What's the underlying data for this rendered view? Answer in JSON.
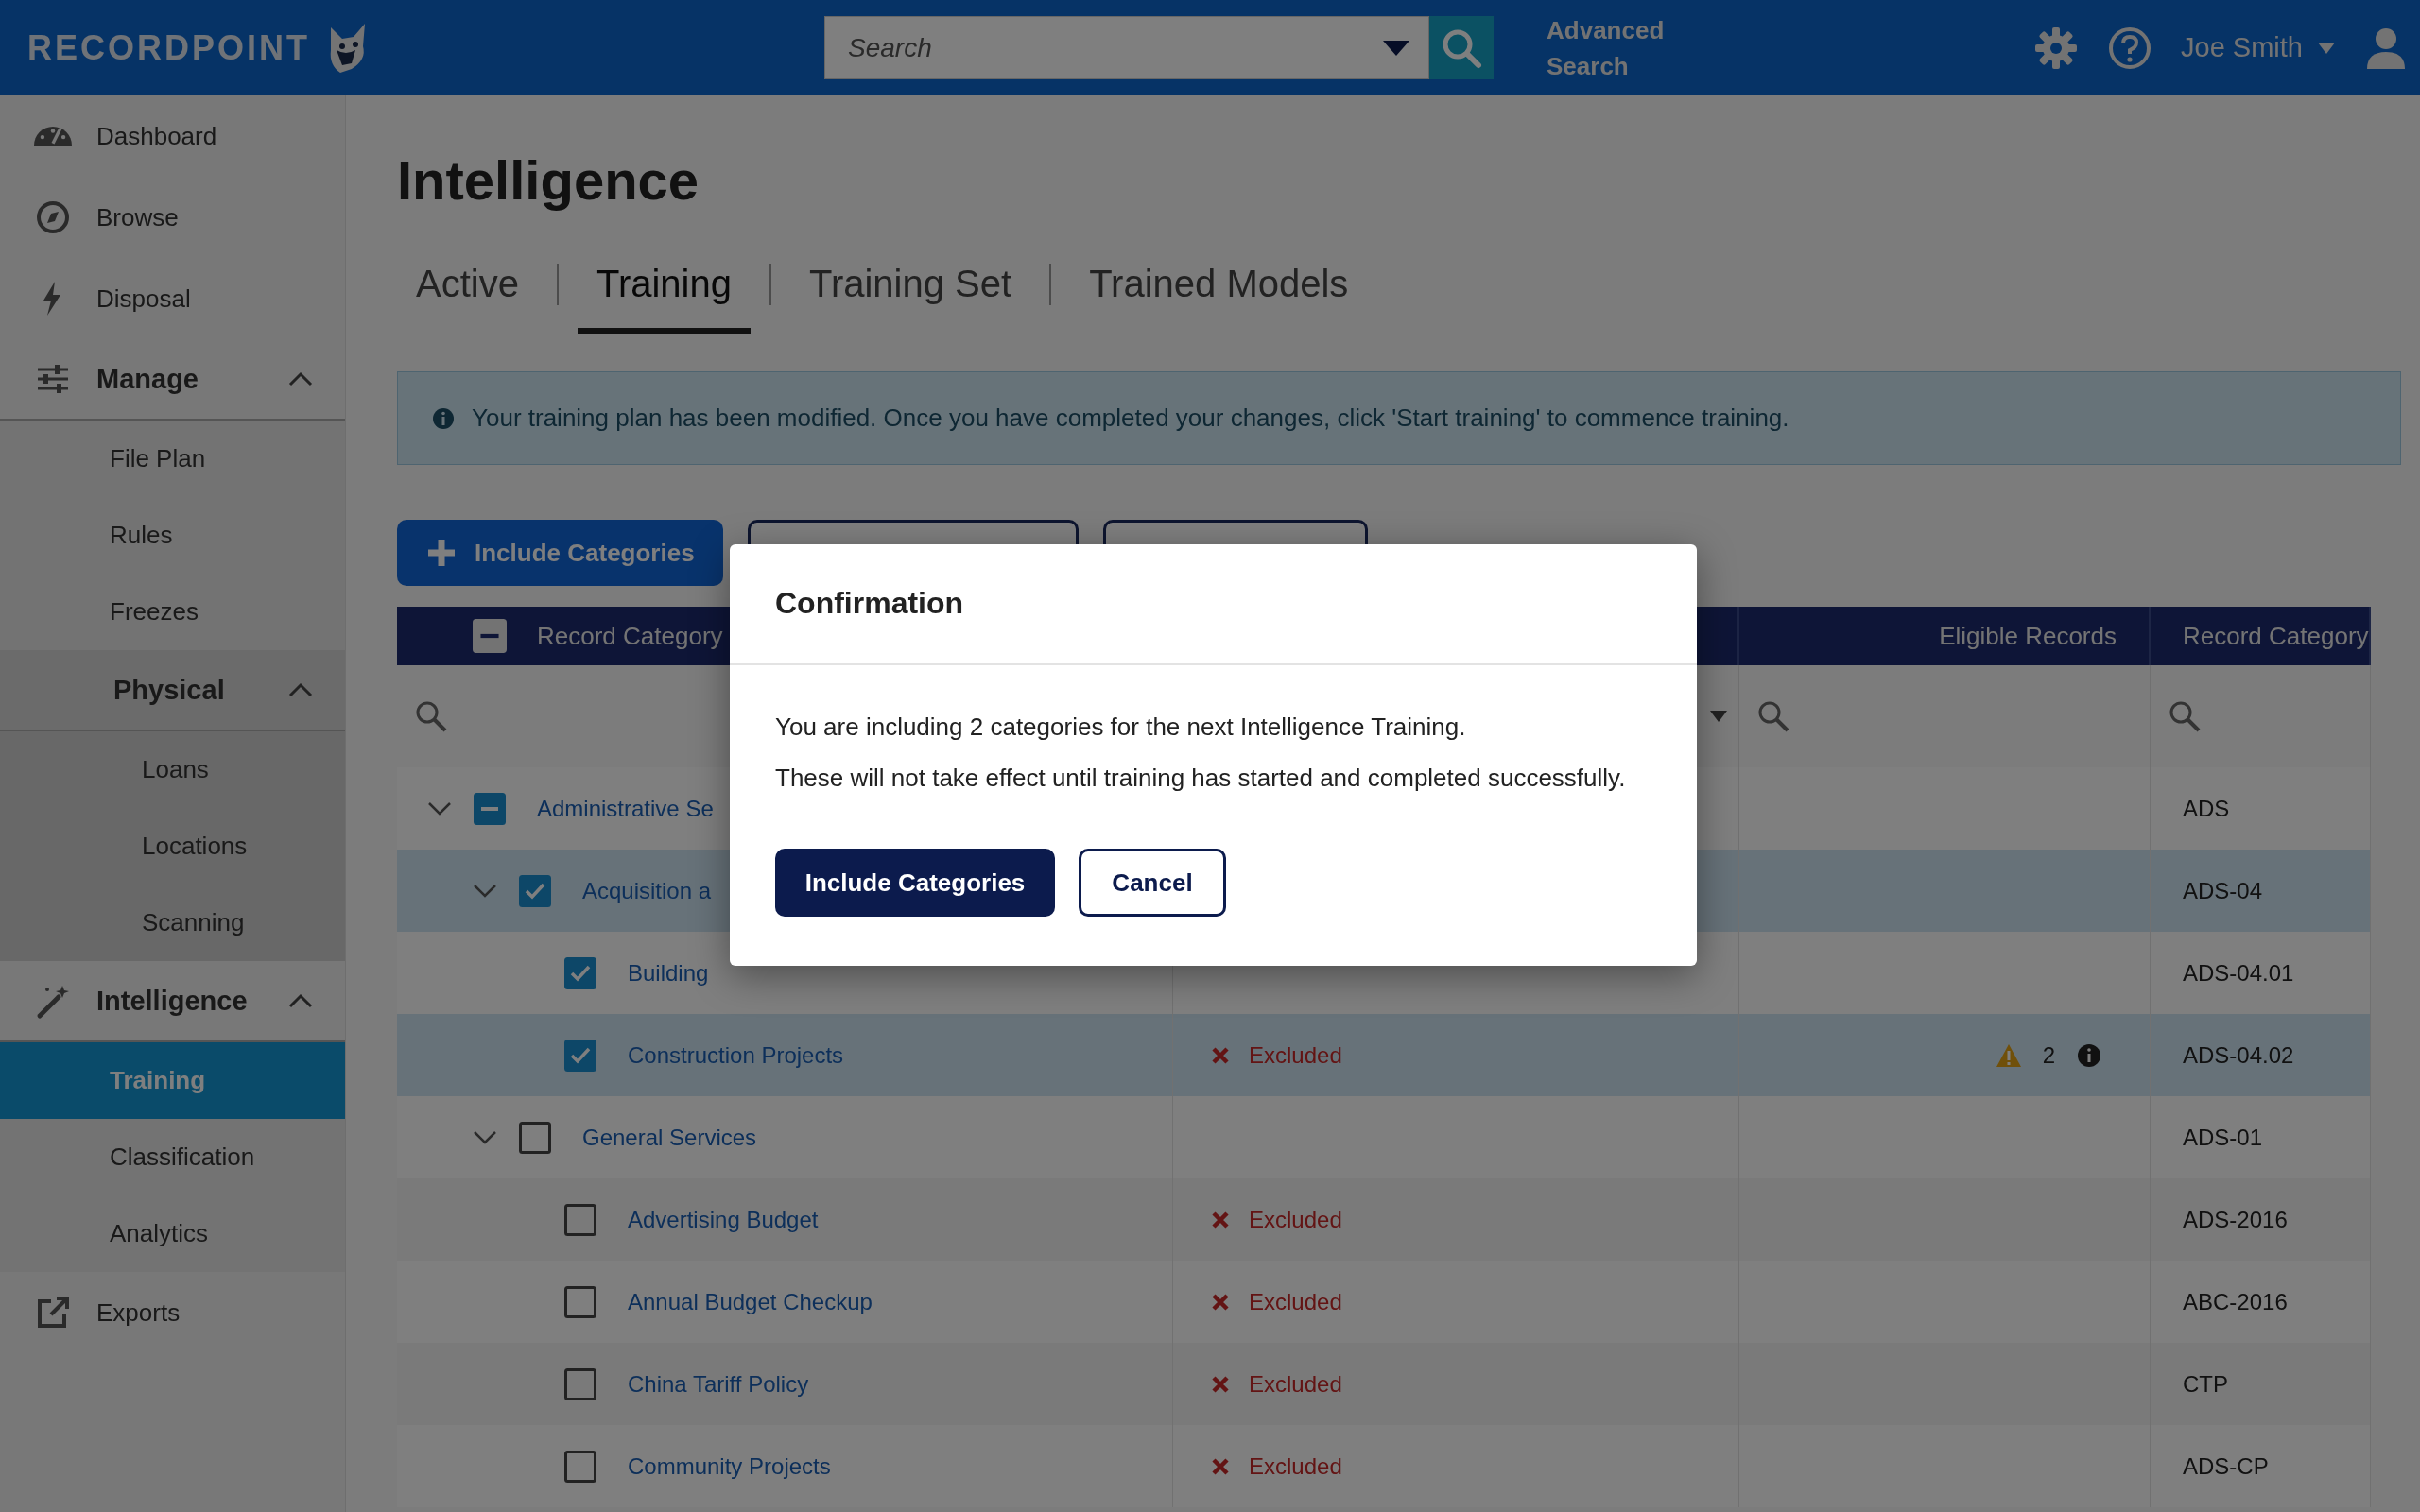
{
  "header": {
    "logo": "RECORDPOINT",
    "search": {
      "placeholder": "Search"
    },
    "advanced_search": "Advanced Search",
    "user": "Joe Smith"
  },
  "sidebar": {
    "items": [
      {
        "label": "Dashboard",
        "selected": false
      },
      {
        "label": "Browse",
        "selected": false
      },
      {
        "label": "Disposal",
        "selected": false
      },
      {
        "label": "Manage",
        "selected": false,
        "expanded": true,
        "children": [
          {
            "label": "File Plan",
            "selected": false
          },
          {
            "label": "Rules",
            "selected": false
          },
          {
            "label": "Freezes",
            "selected": false
          },
          {
            "label": "Physical",
            "selected": false,
            "expanded": true,
            "children": [
              {
                "label": "Loans",
                "selected": false
              },
              {
                "label": "Locations",
                "selected": false
              },
              {
                "label": "Scanning",
                "selected": false
              }
            ]
          }
        ]
      },
      {
        "label": "Intelligence",
        "selected": false,
        "expanded": true,
        "children": [
          {
            "label": "Training",
            "selected": true
          },
          {
            "label": "Classification",
            "selected": false
          },
          {
            "label": "Analytics",
            "selected": false
          }
        ]
      },
      {
        "label": "Exports",
        "selected": false
      }
    ]
  },
  "page": {
    "title": "Intelligence"
  },
  "tabs": [
    {
      "label": "Active",
      "selected": false
    },
    {
      "label": "Training",
      "selected": true
    },
    {
      "label": "Training Set",
      "selected": false
    },
    {
      "label": "Trained Models",
      "selected": false
    }
  ],
  "banner": {
    "message": "Your training plan has been modified. Once you have completed your changes, click 'Start training' to commence training."
  },
  "toolbar": {
    "buttons": [
      {
        "kind": "primary",
        "label": "Include Categories"
      },
      {
        "kind": "outline"
      },
      {
        "kind": "outline"
      }
    ]
  },
  "table": {
    "select_all": {
      "checked": false,
      "partial": true
    },
    "columns": [
      {
        "label": "Record Category",
        "kind": "search"
      },
      {
        "kind": "dropdown"
      },
      {
        "label": "Eligible Records",
        "kind": "search"
      },
      {
        "label": "Record Category",
        "kind": "search"
      }
    ],
    "rows": [
      {
        "name": "Administrative Se",
        "checked": false,
        "partial": true,
        "expanded": true,
        "highlighted": false,
        "code": "ADS",
        "children": [
          {
            "name": "Acquisition a",
            "checked": true,
            "partial": false,
            "expanded": true,
            "highlighted": true,
            "code": "ADS-04",
            "children": [
              {
                "name": "Building",
                "checked": true,
                "partial": false,
                "highlighted": false,
                "code": "ADS-04.01"
              },
              {
                "name": "Construction Projects",
                "checked": true,
                "partial": false,
                "highlighted": true,
                "status": "Excluded",
                "warning": "2",
                "code": "ADS-04.02"
              }
            ]
          },
          {
            "name": "General Services",
            "checked": false,
            "partial": false,
            "expanded": true,
            "highlighted": false,
            "code": "ADS-01",
            "children": [
              {
                "name": "Advertising Budget",
                "checked": false,
                "partial": false,
                "highlighted": false,
                "status": "Excluded",
                "code": "ADS-2016"
              },
              {
                "name": "Annual Budget Checkup",
                "checked": false,
                "partial": false,
                "highlighted": false,
                "status": "Excluded",
                "code": "ABC-2016"
              },
              {
                "name": "China Tariff Policy",
                "checked": false,
                "partial": false,
                "highlighted": false,
                "status": "Excluded",
                "code": "CTP"
              },
              {
                "name": "Community Projects",
                "checked": false,
                "partial": false,
                "highlighted": false,
                "status": "Excluded",
                "code": "ADS-CP"
              }
            ]
          }
        ]
      }
    ]
  },
  "dialog": {
    "title": "Confirmation",
    "lines": [
      "You are including 2 categories for the next Intelligence Training.",
      "These will not take effect until training has started and completed successfully."
    ],
    "buttons": [
      {
        "kind": "primary",
        "label": "Include Categories"
      },
      {
        "kind": "secondary",
        "label": "Cancel"
      }
    ]
  }
}
